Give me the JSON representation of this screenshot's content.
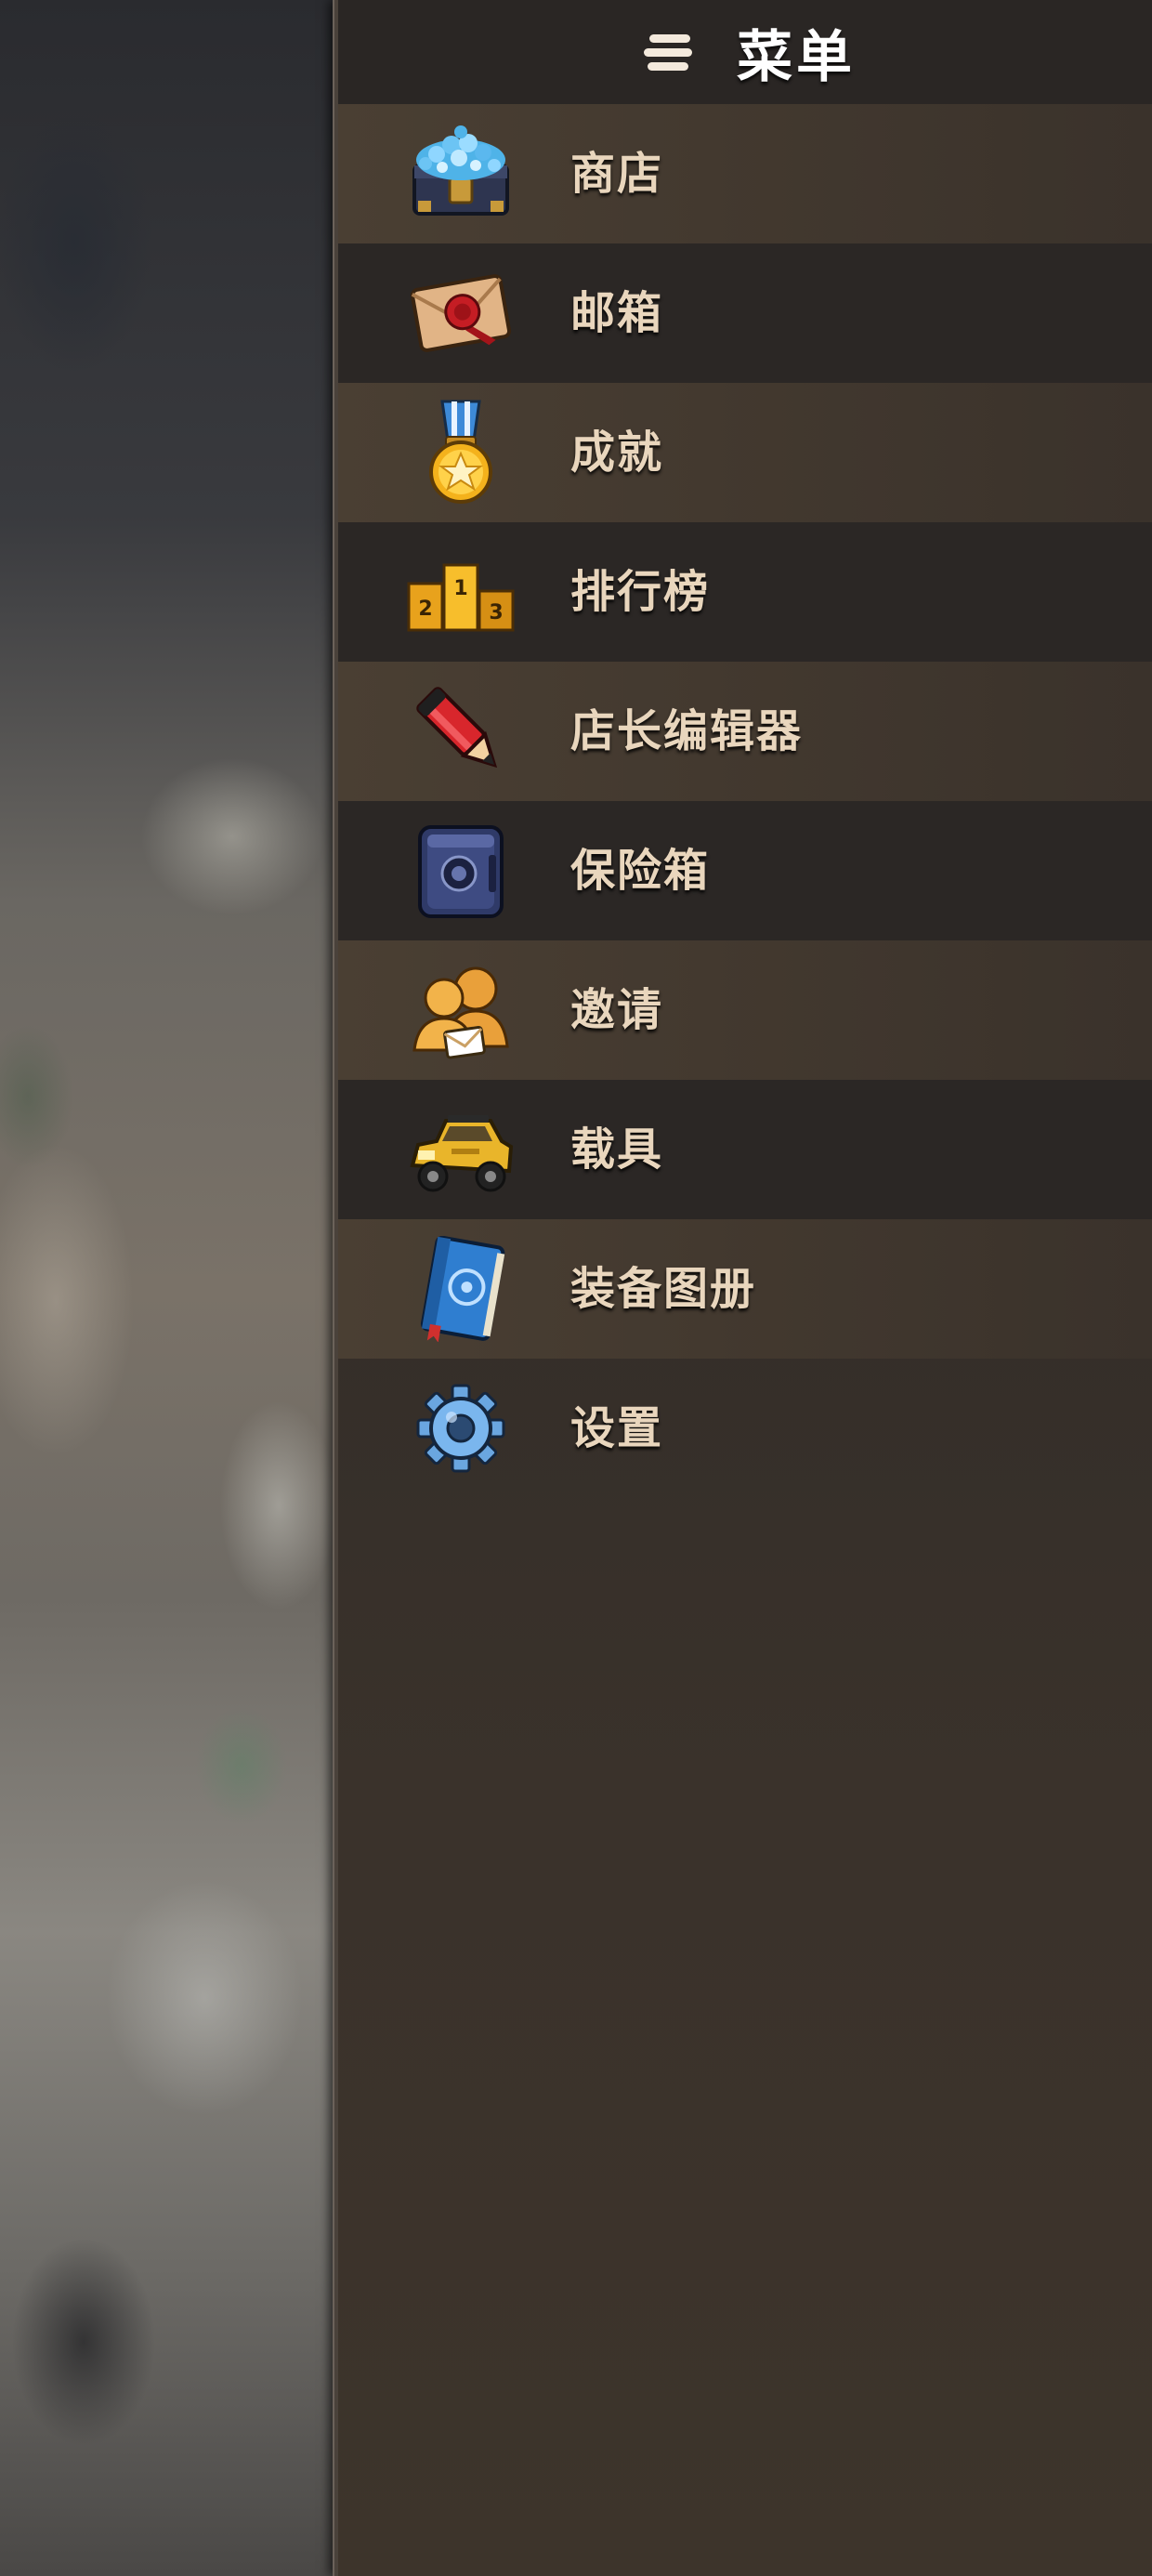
{
  "header": {
    "title": "菜单",
    "icon": "hamburger-menu-icon"
  },
  "menu": {
    "items": [
      {
        "label": "商店",
        "icon": "gem-chest-icon"
      },
      {
        "label": "邮箱",
        "icon": "sealed-envelope-icon"
      },
      {
        "label": "成就",
        "icon": "star-medal-icon"
      },
      {
        "label": "排行榜",
        "icon": "podium-icon"
      },
      {
        "label": "店长编辑器",
        "icon": "red-pencil-icon"
      },
      {
        "label": "保险箱",
        "icon": "safe-icon"
      },
      {
        "label": "邀请",
        "icon": "invite-friends-icon"
      },
      {
        "label": "载具",
        "icon": "yellow-jeep-icon"
      },
      {
        "label": "装备图册",
        "icon": "blue-book-icon"
      },
      {
        "label": "设置",
        "icon": "gear-icon"
      }
    ]
  },
  "colors": {
    "panel_bg": "#2c2826",
    "row_highlight": "#4a3f33",
    "label_text": "#e9d6bd",
    "title_text": "#ffffff"
  }
}
